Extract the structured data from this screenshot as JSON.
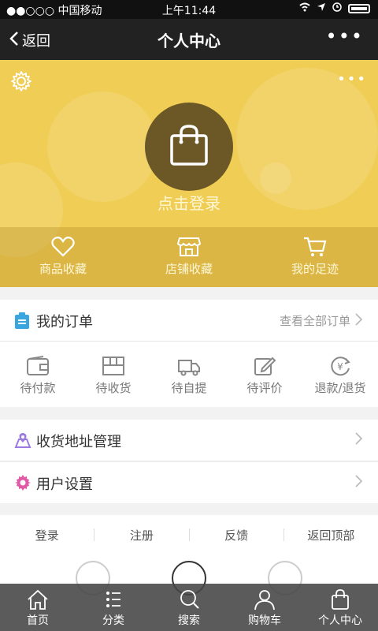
{
  "status_bar": {
    "carrier": "●●○○○ 中国移动",
    "time": "上午11:44"
  },
  "nav": {
    "back_label": "返回",
    "title": "个人中心",
    "more_label": "•••"
  },
  "header": {
    "more_label": "•••",
    "login_label": "点击登录",
    "quick_links": [
      {
        "label": "商品收藏",
        "icon": "heart-icon"
      },
      {
        "label": "店铺收藏",
        "icon": "store-icon"
      },
      {
        "label": "我的足迹",
        "icon": "cart-icon"
      }
    ]
  },
  "orders": {
    "title": "我的订单",
    "view_all": "查看全部订单",
    "items": [
      {
        "label": "待付款",
        "icon": "wallet-icon"
      },
      {
        "label": "待收货",
        "icon": "package-icon"
      },
      {
        "label": "待自提",
        "icon": "truck-icon"
      },
      {
        "label": "待评价",
        "icon": "edit-icon"
      },
      {
        "label": "退款/退货",
        "icon": "refund-icon"
      }
    ]
  },
  "menu": {
    "address": "收货地址管理",
    "settings": "用户设置"
  },
  "footer_links": [
    "登录",
    "注册",
    "反馈",
    "返回顶部"
  ],
  "tabs": [
    {
      "label": "首页",
      "icon": "home-icon"
    },
    {
      "label": "分类",
      "icon": "list-icon"
    },
    {
      "label": "搜索",
      "icon": "search-icon"
    },
    {
      "label": "购物车",
      "icon": "user-icon"
    },
    {
      "label": "个人中心",
      "icon": "bag-icon"
    }
  ],
  "colors": {
    "header_bg": "#f0cd55",
    "avatar_bg": "#6b5826",
    "tabbar_bg": "#464646",
    "order_icon": "#3aa6e0",
    "address_icon": "#9b7be0",
    "settings_icon": "#e05aa6"
  }
}
